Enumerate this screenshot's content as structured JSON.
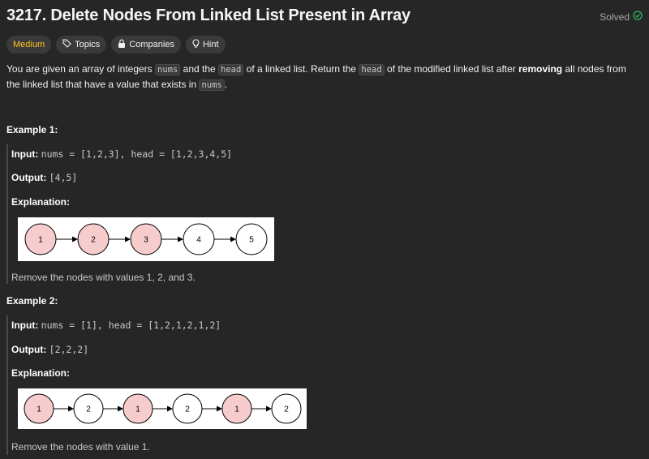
{
  "problem": {
    "title": "3217. Delete Nodes From Linked List Present in Array",
    "status": "Solved"
  },
  "tags": {
    "difficulty": "Medium",
    "topics": "Topics",
    "companies": "Companies",
    "hint": "Hint"
  },
  "description": {
    "part1": "You are given an array of integers ",
    "code_nums": "nums",
    "part2": " and the ",
    "code_head": "head",
    "part3": " of a linked list. Return the ",
    "code_head2": "head",
    "part4": " of the modified linked list after ",
    "bold_removing": "removing",
    "part5": " all nodes from the linked list that have a value that exists in ",
    "code_nums2": "nums",
    "part6": "."
  },
  "examples": [
    {
      "heading": "Example 1:",
      "input_label": "Input:",
      "input_value": "nums = [1,2,3], head = [1,2,3,4,5]",
      "output_label": "Output:",
      "output_value": "[4,5]",
      "explanation_label": "Explanation:",
      "nodes": [
        {
          "value": "1",
          "removed": true
        },
        {
          "value": "2",
          "removed": true
        },
        {
          "value": "3",
          "removed": true
        },
        {
          "value": "4",
          "removed": false
        },
        {
          "value": "5",
          "removed": false
        }
      ],
      "note": "Remove the nodes with values 1, 2, and 3."
    },
    {
      "heading": "Example 2:",
      "input_label": "Input:",
      "input_value": "nums = [1], head = [1,2,1,2,1,2]",
      "output_label": "Output:",
      "output_value": "[2,2,2]",
      "explanation_label": "Explanation:",
      "nodes": [
        {
          "value": "1",
          "removed": true
        },
        {
          "value": "2",
          "removed": false
        },
        {
          "value": "1",
          "removed": true
        },
        {
          "value": "2",
          "removed": false
        },
        {
          "value": "1",
          "removed": true
        },
        {
          "value": "2",
          "removed": false
        }
      ],
      "note": "Remove the nodes with value 1."
    }
  ],
  "colors": {
    "removed_fill": "#f6cccc",
    "kept_fill": "#ffffff",
    "difficulty": "#ffc01e",
    "solved_check": "#2cbb5d"
  }
}
